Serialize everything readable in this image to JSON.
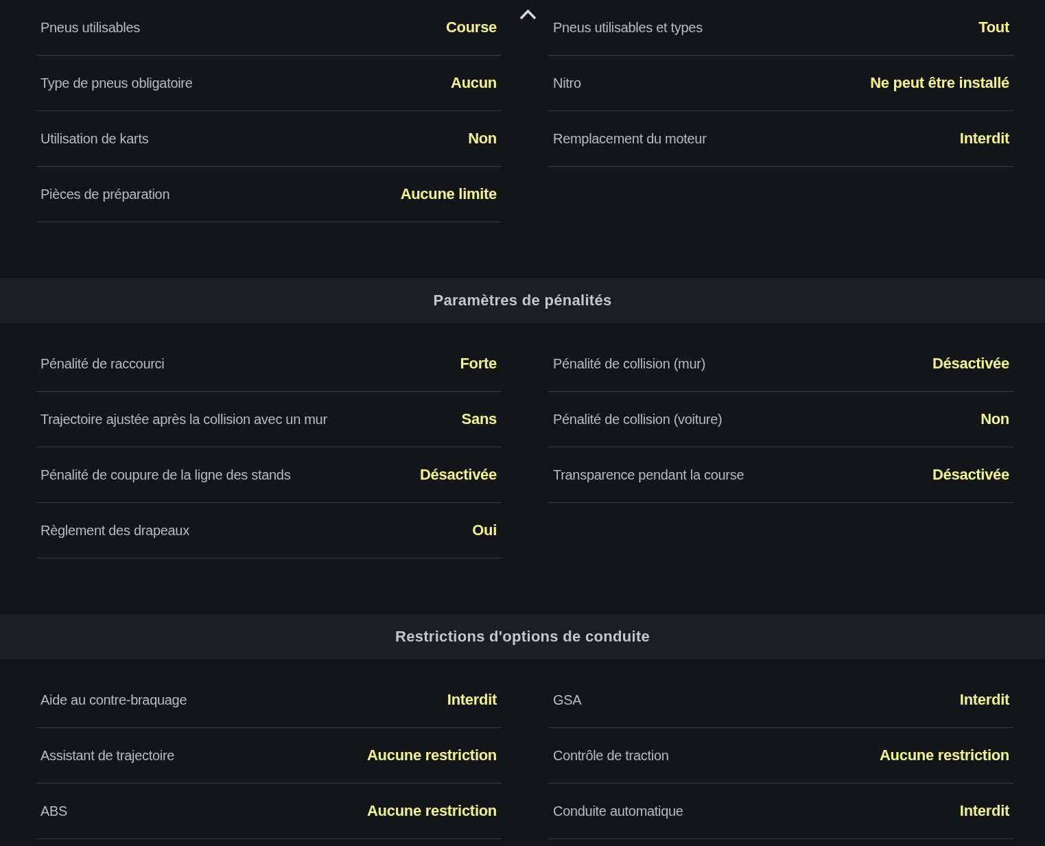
{
  "scroll_up": true,
  "sections": [
    {
      "left": [
        {
          "label": "Pneus utilisables",
          "value": "Course"
        },
        {
          "label": "Type de pneus obligatoire",
          "value": "Aucun"
        },
        {
          "label": "Utilisation de karts",
          "value": "Non"
        },
        {
          "label": "Pièces de préparation",
          "value": "Aucune limite"
        }
      ],
      "right": [
        {
          "label": "Pneus utilisables et types",
          "value": "Tout"
        },
        {
          "label": "Nitro",
          "value": "Ne peut être installé"
        },
        {
          "label": "Remplacement du moteur",
          "value": "Interdit"
        }
      ]
    },
    {
      "title": "Paramètres de pénalités",
      "left": [
        {
          "label": "Pénalité de raccourci",
          "value": "Forte"
        },
        {
          "label": "Trajectoire ajustée après la collision avec un mur",
          "value": "Sans"
        },
        {
          "label": "Pénalité de coupure de la ligne des stands",
          "value": "Désactivée"
        },
        {
          "label": "Règlement des drapeaux",
          "value": "Oui"
        }
      ],
      "right": [
        {
          "label": "Pénalité de collision (mur)",
          "value": "Désactivée"
        },
        {
          "label": "Pénalité de collision (voiture)",
          "value": "Non"
        },
        {
          "label": "Transparence pendant la course",
          "value": "Désactivée"
        }
      ]
    },
    {
      "title": "Restrictions d'options de conduite",
      "left": [
        {
          "label": "Aide au contre-braquage",
          "value": "Interdit"
        },
        {
          "label": "Assistant de trajectoire",
          "value": "Aucune restriction"
        },
        {
          "label": "ABS",
          "value": "Aucune restriction"
        }
      ],
      "right": [
        {
          "label": "GSA",
          "value": "Interdit"
        },
        {
          "label": "Contrôle de traction",
          "value": "Aucune restriction"
        },
        {
          "label": "Conduite automatique",
          "value": "Interdit"
        }
      ]
    }
  ]
}
